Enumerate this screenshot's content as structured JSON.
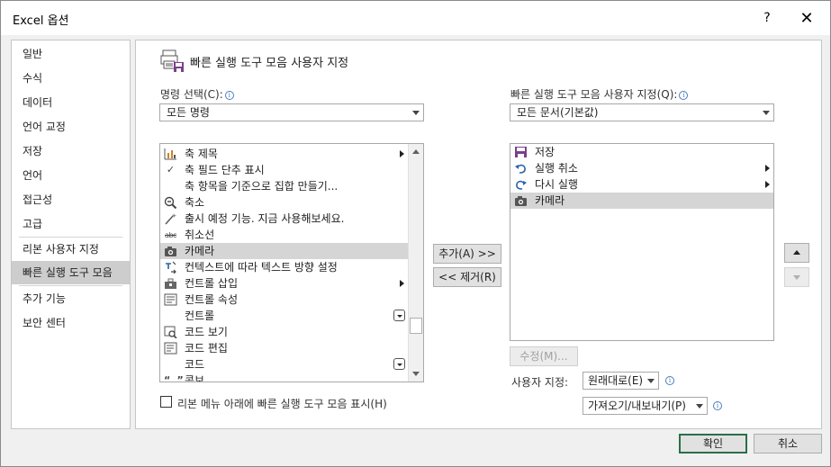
{
  "window": {
    "title": "Excel 옵션",
    "help_label": "?",
    "close_label": "✕"
  },
  "sidebar": {
    "items": [
      {
        "label": "일반"
      },
      {
        "label": "수식"
      },
      {
        "label": "데이터"
      },
      {
        "label": "언어 교정"
      },
      {
        "label": "저장"
      },
      {
        "label": "언어"
      },
      {
        "label": "접근성"
      },
      {
        "label": "고급"
      },
      {
        "label": "리본 사용자 지정"
      },
      {
        "label": "빠른 실행 도구 모음"
      },
      {
        "label": "추가 기능"
      },
      {
        "label": "보안 센터"
      }
    ],
    "active_index": 9
  },
  "header": {
    "title": "빠른 실행 도구 모음 사용자 지정"
  },
  "commands": {
    "label": "명령 선택(C):",
    "selected": "모든 명령",
    "items": [
      {
        "icon": "chart-axis-icon",
        "label": "축 제목",
        "submenu": true
      },
      {
        "icon": "checkmark-icon",
        "label": "축 필드 단추 표시"
      },
      {
        "icon": "",
        "label": "축 항목을 기준으로 집합 만들기..."
      },
      {
        "icon": "zoom-out-icon",
        "label": "축소"
      },
      {
        "icon": "magic-wand-icon",
        "label": "출시 예정 기능. 지금 사용해보세요."
      },
      {
        "icon": "strikethrough-icon",
        "label": "취소선"
      },
      {
        "icon": "camera-icon",
        "label": "카메라",
        "selected": true
      },
      {
        "icon": "text-direction-icon",
        "label": "컨텍스트에 따라 텍스트 방향 설정"
      },
      {
        "icon": "toolbox-icon",
        "label": "컨트롤 삽입",
        "submenu": true
      },
      {
        "icon": "properties-icon",
        "label": "컨트롤 속성"
      },
      {
        "icon": "",
        "label": "컨트롤",
        "dropdown": true
      },
      {
        "icon": "view-code-icon",
        "label": "코드 보기"
      },
      {
        "icon": "edit-code-icon",
        "label": "코드 편집"
      },
      {
        "icon": "",
        "label": "코드",
        "dropdown": true
      },
      {
        "icon": "quote-icon",
        "label": "콤보"
      }
    ]
  },
  "qat": {
    "label": "빠른 실행 도구 모음 사용자 지정(Q):",
    "selected": "모든 문서(기본값)",
    "items": [
      {
        "icon": "save-icon",
        "label": "저장"
      },
      {
        "icon": "undo-icon",
        "label": "실행 취소",
        "submenu": true
      },
      {
        "icon": "redo-icon",
        "label": "다시 실행",
        "submenu": true
      },
      {
        "icon": "camera-icon",
        "label": "카메라",
        "selected": true
      }
    ]
  },
  "buttons": {
    "add": "추가(A) >>",
    "remove": "<< 제거(R)",
    "modify": "수정(M)...",
    "reset": "원래대로(E)",
    "import_export": "가져오기/내보내기(P)",
    "ok": "확인",
    "cancel": "취소"
  },
  "customize_label": "사용자 지정:",
  "show_below_ribbon": {
    "label": "리본 메뉴 아래에 빠른 실행 도구 모음 표시(H)",
    "checked": false
  }
}
